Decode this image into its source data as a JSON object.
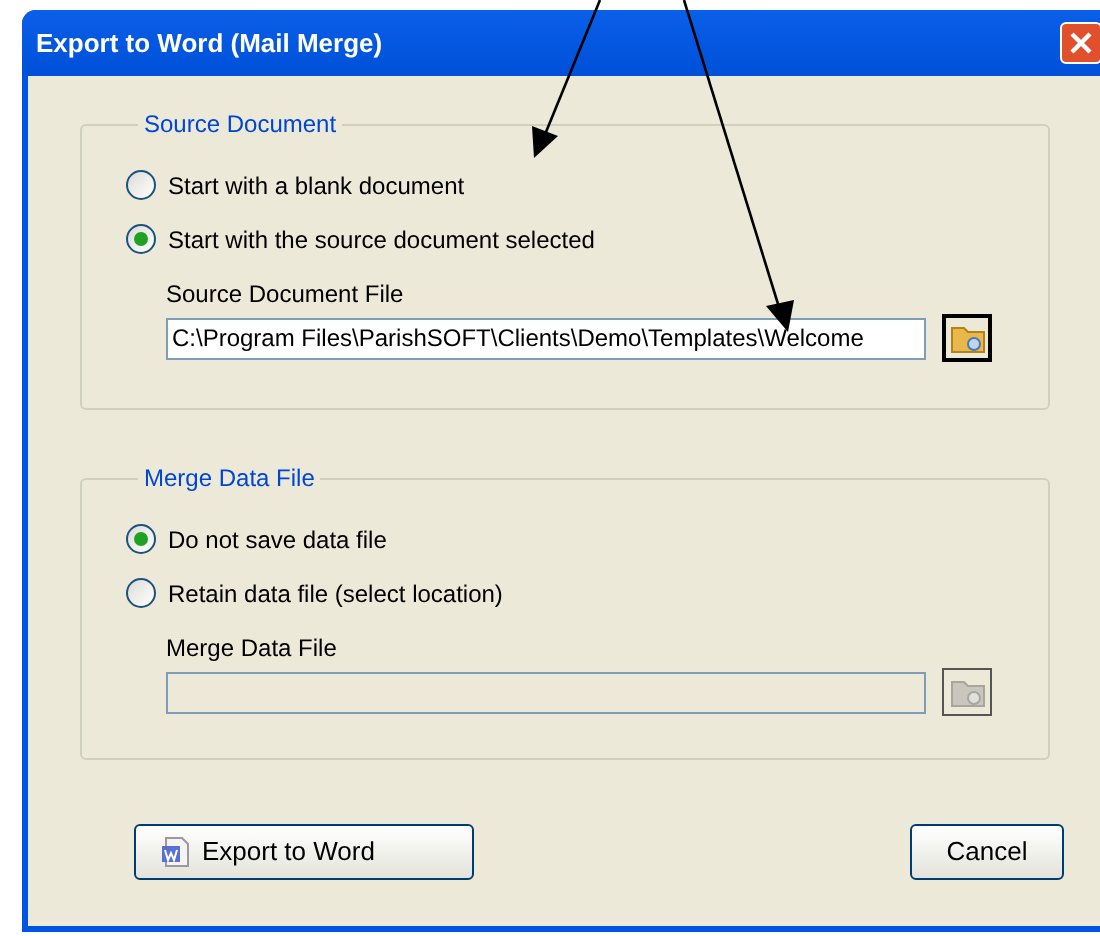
{
  "window": {
    "title": "Export to Word (Mail Merge)"
  },
  "groups": [
    {
      "title": "Source Document",
      "options": [
        {
          "label": "Start with a blank document",
          "selected": false
        },
        {
          "label": "Start with the source document selected",
          "selected": true
        }
      ],
      "field_label": "Source Document File",
      "value": "C:\\Program Files\\ParishSOFT\\Clients\\Demo\\Templates\\Welcome",
      "disabled": false
    },
    {
      "title": "Merge Data File",
      "options": [
        {
          "label": "Do not save data file",
          "selected": true
        },
        {
          "label": "Retain data file (select location)",
          "selected": false
        }
      ],
      "field_label": "Merge Data File",
      "disabled": true
    }
  ],
  "buttons": [
    {
      "label": "Export to Word",
      "kind": "word"
    },
    {
      "label": "Cancel",
      "kind": "plain"
    }
  ]
}
